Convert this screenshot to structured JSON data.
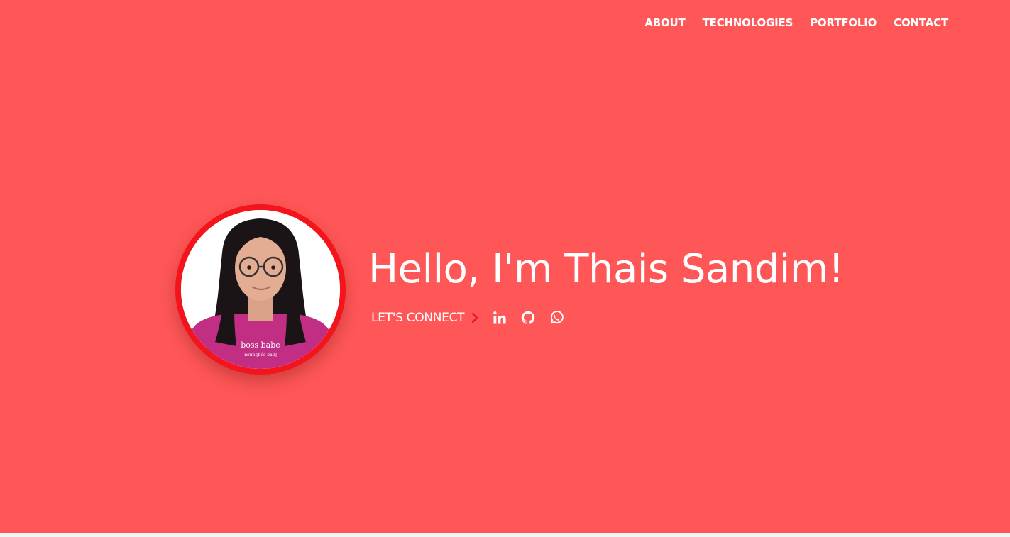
{
  "nav": {
    "items": [
      {
        "label": "ABOUT"
      },
      {
        "label": "TECHNOLOGIES"
      },
      {
        "label": "PORTFOLIO"
      },
      {
        "label": "CONTACT"
      }
    ]
  },
  "hero": {
    "title": "Hello, I'm Thais Sandim!",
    "connect_label": "LET'S CONNECT",
    "shirt_text": "boss babe",
    "shirt_subtext": "noun [bôs-bāb]",
    "social_icons": [
      "linkedin-icon",
      "github-icon",
      "whatsapp-icon"
    ]
  },
  "colors": {
    "background": "#ff5757",
    "avatar_ring": "#f4151c",
    "chevron": "#e8151b",
    "text": "#ffffff"
  }
}
